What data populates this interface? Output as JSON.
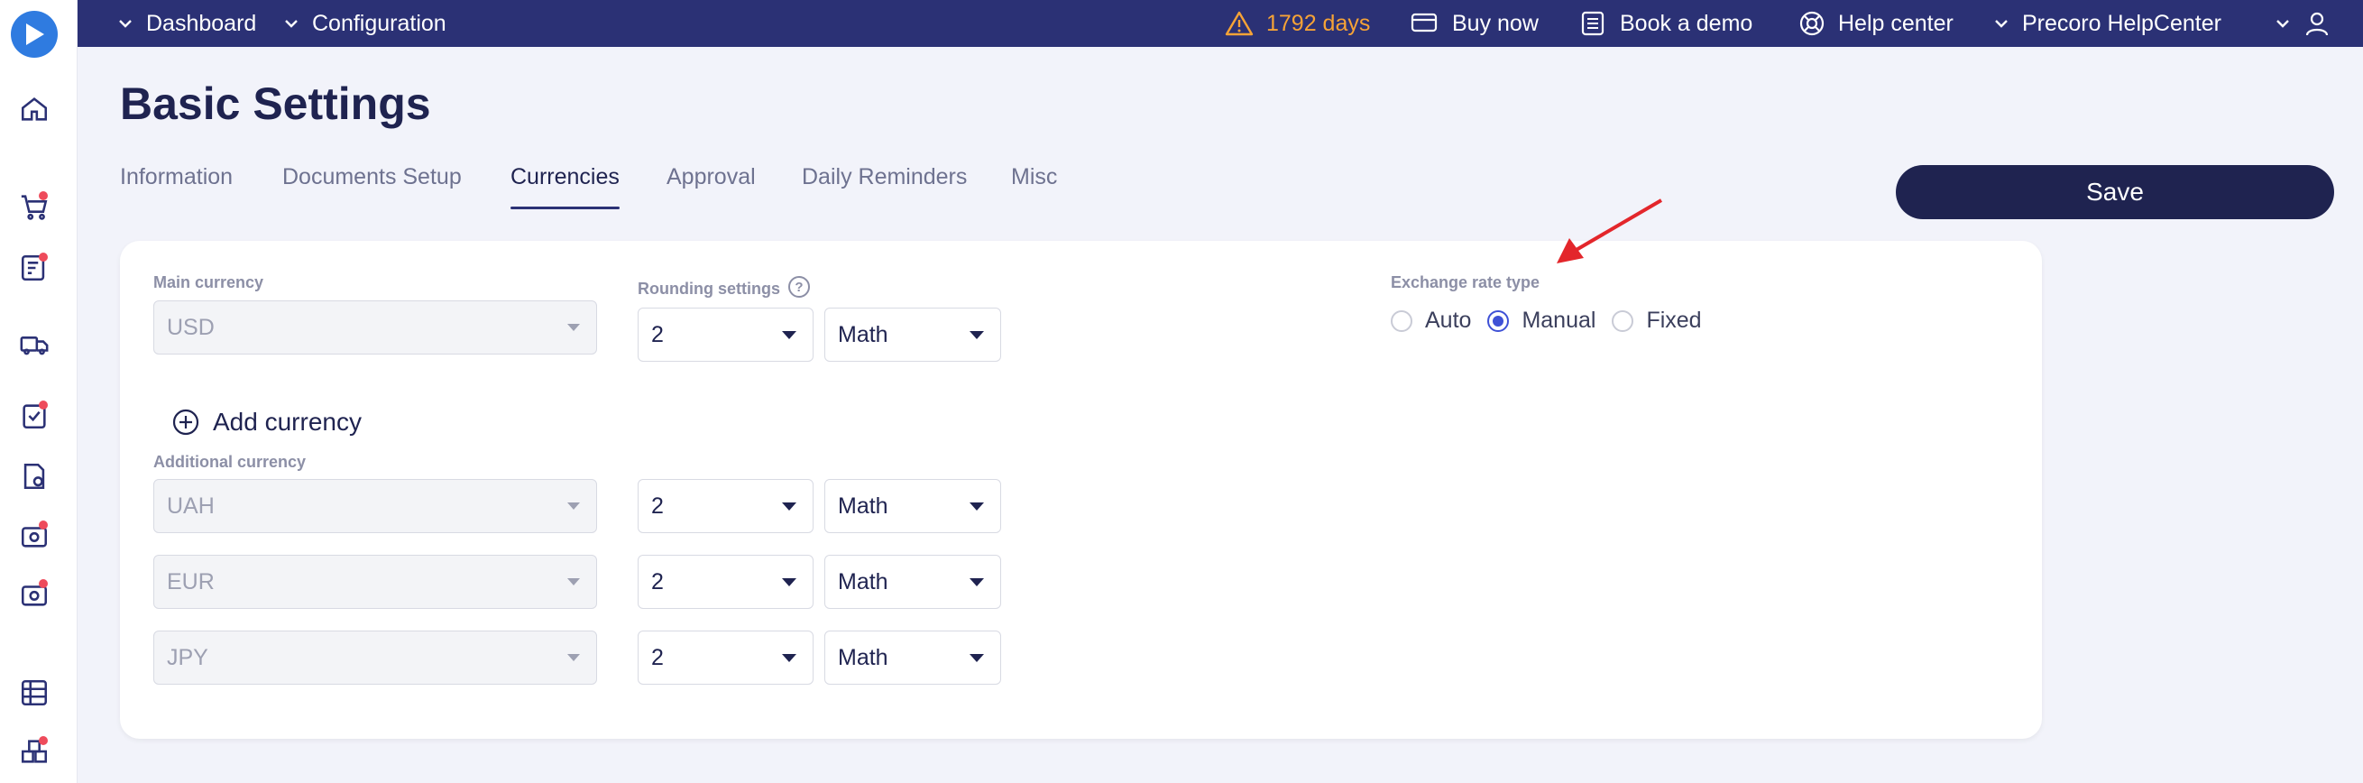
{
  "topbar": {
    "dashboard": "Dashboard",
    "configuration": "Configuration",
    "trial_days": "1792 days",
    "buy_now": "Buy now",
    "book_demo": "Book a demo",
    "help_center": "Help center",
    "company": "Precoro HelpCenter"
  },
  "page": {
    "title": "Basic Settings",
    "tabs": [
      "Information",
      "Documents Setup",
      "Currencies",
      "Approval",
      "Daily Reminders",
      "Misc"
    ],
    "active_tab": "Currencies",
    "save_label": "Save"
  },
  "settings": {
    "main_currency_label": "Main currency",
    "main_currency": "USD",
    "rounding_label": "Rounding settings",
    "rounding_precision": "2",
    "rounding_method": "Math",
    "add_currency_label": "Add currency",
    "additional_currency_label": "Additional currency",
    "additional": [
      {
        "currency": "UAH",
        "precision": "2",
        "method": "Math"
      },
      {
        "currency": "EUR",
        "precision": "2",
        "method": "Math"
      },
      {
        "currency": "JPY",
        "precision": "2",
        "method": "Math"
      }
    ],
    "exchange_rate_label": "Exchange rate type",
    "exchange_options": [
      "Auto",
      "Manual",
      "Fixed"
    ],
    "exchange_selected": "Manual"
  },
  "colors": {
    "topbar": "#2b3175",
    "accent": "#3f51d6",
    "warning": "#f6a336",
    "notification_dot": "#ee4b5b",
    "annotation_arrow": "#e3262b"
  }
}
